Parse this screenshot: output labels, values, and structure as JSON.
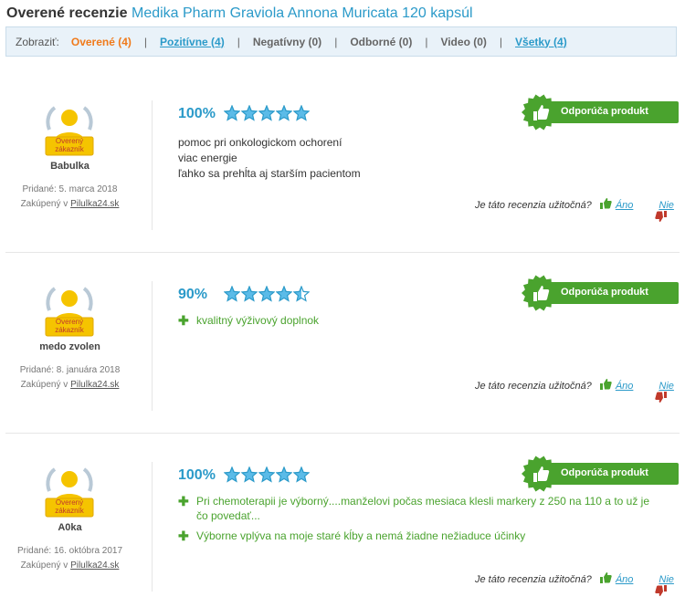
{
  "header": {
    "prefix": "Overené recenzie",
    "product": "Medika Pharm Graviola Annona Muricata 120 kapsúl"
  },
  "filter": {
    "label": "Zobraziť:",
    "items": [
      {
        "label": "Overené (4)",
        "state": "active"
      },
      {
        "label": "Pozitívne (4)",
        "state": "link"
      },
      {
        "label": "Negatívny (0)",
        "state": "disabled"
      },
      {
        "label": "Odborné (0)",
        "state": "disabled"
      },
      {
        "label": "Video (0)",
        "state": "disabled"
      },
      {
        "label": "Všetky (4)",
        "state": "link"
      }
    ],
    "separator": "|"
  },
  "badge_text": [
    "Overený",
    "zákazník"
  ],
  "recommend_label": "Odporúča produkt",
  "useful": {
    "question": "Je táto recenzia užitočná?",
    "yes": "Áno",
    "no": "Nie"
  },
  "reviews": [
    {
      "user": "Babulka",
      "added": "Pridané: 5. marca 2018",
      "bought_prefix": "Zakúpený v",
      "shop": "Pilulka24.sk",
      "rating": "100%",
      "stars": 5,
      "text_lines": [
        "pomoc pri onkologickom ochorení",
        "viac energie",
        "ľahko sa prehĺta aj starším pacientom"
      ]
    },
    {
      "user": "medo zvolen",
      "added": "Pridané: 8. januára 2018",
      "bought_prefix": "Zakúpený v",
      "shop": "Pilulka24.sk",
      "rating": "90%",
      "stars": 4.5,
      "pros": [
        "kvalitný výživový doplnok"
      ]
    },
    {
      "user": "A0ka",
      "added": "Pridané: 16. októbra 2017",
      "bought_prefix": "Zakúpený v",
      "shop": "Pilulka24.sk",
      "rating": "100%",
      "stars": 5,
      "pros": [
        "Pri chemoterapii je výborný....manželovi počas mesiaca klesli markery z 250 na 110 a to už je čo povedať...",
        "Výborne vplýva na moje staré kĺby a nemá žiadne nežiaduce účinky"
      ]
    }
  ],
  "colors": {
    "accent": "#2b9ac9",
    "active": "#f07a1a",
    "green": "#4aa32e",
    "red": "#c0392b"
  }
}
